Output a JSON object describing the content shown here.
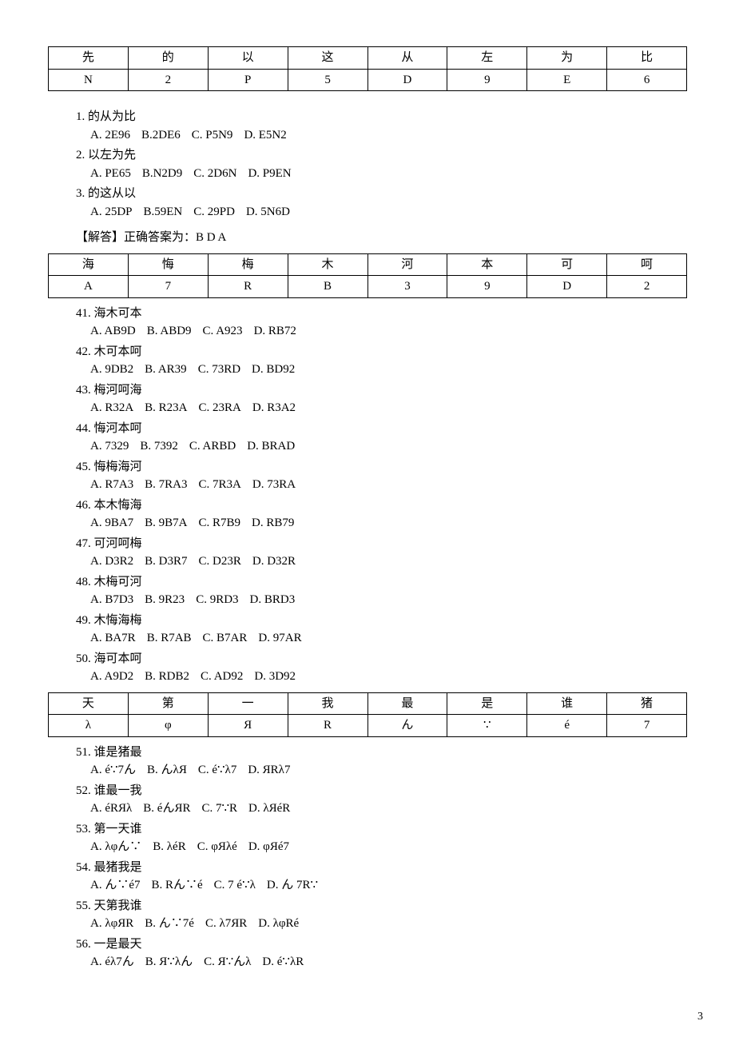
{
  "table1": {
    "row1": [
      "先",
      "的",
      "以",
      "这",
      "从",
      "左",
      "为",
      "比"
    ],
    "row2": [
      "N",
      "2",
      "P",
      "5",
      "D",
      "9",
      "E",
      "6"
    ]
  },
  "block1": {
    "q1": {
      "num": "1.",
      "text": "的从为比",
      "opts": [
        "A. 2E96",
        "B.2DE6",
        "C. P5N9",
        "D. E5N2"
      ]
    },
    "q2": {
      "num": "2.",
      "text": "以左为先",
      "opts": [
        "A. PE65",
        "B.N2D9",
        "C. 2D6N",
        "D. P9EN"
      ]
    },
    "q3": {
      "num": "3.",
      "text": "的这从以",
      "opts": [
        "A. 25DP",
        "B.59EN",
        "C. 29PD",
        "D. 5N6D"
      ]
    },
    "answer": "【解答】正确答案为：B D A"
  },
  "table2": {
    "row1": [
      "海",
      "悔",
      "梅",
      "木",
      "河",
      "本",
      "可",
      "呵"
    ],
    "row2": [
      "A",
      "7",
      "R",
      "B",
      "3",
      "9",
      "D",
      "2"
    ]
  },
  "block2": {
    "q41": {
      "num": "41.",
      "text": "海木可本",
      "opts": [
        "A. AB9D",
        "B. ABD9",
        "C. A923",
        "D. RB72"
      ]
    },
    "q42": {
      "num": "42.",
      "text": "木可本呵",
      "opts": [
        "A. 9DB2",
        "B. AR39",
        "C. 73RD",
        "D. BD92"
      ]
    },
    "q43": {
      "num": "43.",
      "text": "梅河呵海",
      "opts": [
        "A. R32A",
        "B. R23A",
        "C. 23RA",
        "D. R3A2"
      ]
    },
    "q44": {
      "num": "44.",
      "text": "悔河本呵",
      "opts": [
        "A. 7329",
        "B. 7392",
        "C. ARBD",
        "D. BRAD"
      ]
    },
    "q45": {
      "num": "45.",
      "text": "悔梅海河",
      "opts": [
        "A. R7A3",
        "B. 7RA3",
        "C. 7R3A",
        "D. 73RA"
      ]
    },
    "q46": {
      "num": "46.",
      "text": "本木悔海",
      "opts": [
        "A. 9BA7",
        "B. 9B7A",
        "C. R7B9",
        "D. RB79"
      ]
    },
    "q47": {
      "num": "47.",
      "text": "可河呵梅",
      "opts": [
        "A. D3R2",
        "B. D3R7",
        "C. D23R",
        "D. D32R"
      ]
    },
    "q48": {
      "num": "48.",
      "text": "木梅可河",
      "opts": [
        "A. B7D3",
        "B. 9R23",
        "C. 9RD3",
        "D. BRD3"
      ]
    },
    "q49": {
      "num": "49.",
      "text": "木悔海梅",
      "opts": [
        "A. BA7R",
        "B. R7AB",
        "C. B7AR",
        "D. 97AR"
      ]
    },
    "q50": {
      "num": "50.",
      "text": "海可本呵",
      "opts": [
        "A. A9D2",
        "B. RDB2",
        "C. AD92",
        "D. 3D92"
      ]
    }
  },
  "table3": {
    "row1": [
      "天",
      "第",
      "一",
      "我",
      "最",
      "是",
      "谁",
      "猪"
    ],
    "row2": [
      "λ",
      "φ",
      "Я",
      "R",
      "ん",
      "∵",
      "é",
      "7"
    ]
  },
  "block3": {
    "q51": {
      "num": "51.",
      "text": "谁是猪最",
      "opts": [
        "A. é∵7ん",
        "B. んλЯ",
        "C. é∵λ7",
        "D. ЯRλ7"
      ]
    },
    "q52": {
      "num": "52.",
      "text": "谁最一我",
      "opts": [
        "A. éRЯλ",
        "B. éんЯR",
        "C. 7∵R",
        "D.  λЯéR"
      ]
    },
    "q53": {
      "num": "53.",
      "text": "第一天谁",
      "opts": [
        "A. λφん∵",
        "B.   λéR",
        "C. φЯλé",
        "D. φЯé7"
      ]
    },
    "q54": {
      "num": "54.",
      "text": "最猪我是",
      "opts": [
        "A. ん∵é7",
        "B. Rん∵é",
        "C. 7 é∵λ",
        "D.  ん 7R∵"
      ]
    },
    "q55": {
      "num": "55.",
      "text": "天第我谁",
      "opts": [
        "A. λφЯR",
        "B.  ん∵7é",
        "C.  λ7ЯR",
        "D.   λφRé"
      ]
    },
    "q56": {
      "num": "56.",
      "text": "一是最天",
      "opts": [
        "A. éλ7ん",
        "B.  Я∵λん",
        "C.  Я∵んλ",
        "D.  é∵λR"
      ]
    }
  },
  "pagenum": "3"
}
